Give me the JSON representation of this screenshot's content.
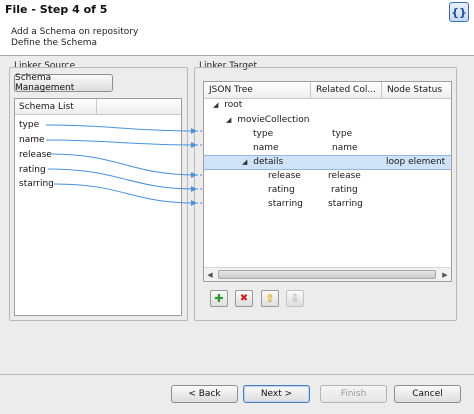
{
  "window": {
    "title": "File - Step 4 of 5",
    "subtitle_line1": "Add a Schema on repository",
    "subtitle_line2": "Define the Schema",
    "wizard_icon_glyph": "{}"
  },
  "linker_source": {
    "group_label": "Linker Source",
    "schema_management_button": "Schema Management",
    "schema_list_header": "Schema List",
    "items": [
      "type",
      "name",
      "release",
      "rating",
      "starring"
    ]
  },
  "linker_target": {
    "group_label": "Linker Target",
    "columns": [
      "JSON Tree",
      "Related Col...",
      "Node Status"
    ],
    "rows": [
      {
        "label": "root",
        "related": "",
        "status": "",
        "expander": "◢"
      },
      {
        "label": "movieCollection",
        "related": "",
        "status": "",
        "expander": "◢"
      },
      {
        "label": "type",
        "related": "type",
        "status": "",
        "expander": ""
      },
      {
        "label": "name",
        "related": "name",
        "status": "",
        "expander": ""
      },
      {
        "label": "details",
        "related": "",
        "status": "loop element",
        "expander": "◢"
      },
      {
        "label": "release",
        "related": "release",
        "status": "",
        "expander": ""
      },
      {
        "label": "rating",
        "related": "rating",
        "status": "",
        "expander": ""
      },
      {
        "label": "starring",
        "related": "starring",
        "status": "",
        "expander": ""
      }
    ],
    "toolbar_icons": [
      "plus-icon",
      "delete-icon",
      "move-up-icon",
      "move-down-icon"
    ],
    "toolbar_glyphs": {
      "add": "✚",
      "remove": "✖",
      "up": "⇧",
      "down": "⇩"
    },
    "scroll_left_glyph": "◀",
    "scroll_right_glyph": "▶"
  },
  "links": [
    {
      "source": "type",
      "target": "type"
    },
    {
      "source": "name",
      "target": "name"
    },
    {
      "source": "release",
      "target": "release"
    },
    {
      "source": "rating",
      "target": "rating"
    },
    {
      "source": "starring",
      "target": "starring"
    }
  ],
  "colors": {
    "link_line": "#4a90d9",
    "selected_row": "#cfe2f8",
    "add_icon": "#2e9a2e",
    "remove_icon": "#cc2222",
    "up_icon": "#d9a400",
    "down_icon_disabled": "#b8b8b8"
  },
  "footer": {
    "back": "< Back",
    "next": "Next >",
    "finish": "Finish",
    "cancel": "Cancel"
  }
}
